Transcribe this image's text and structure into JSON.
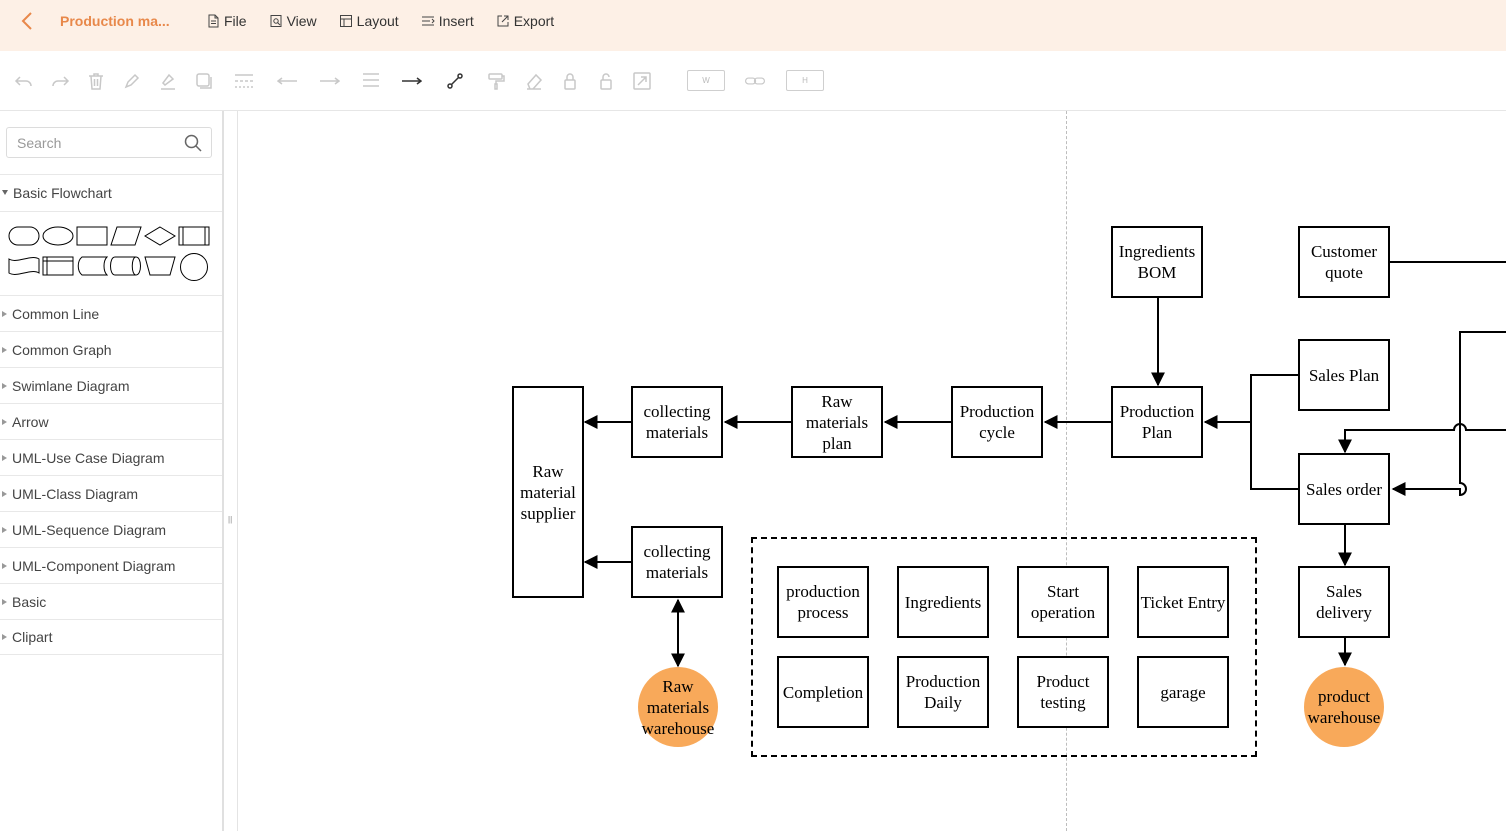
{
  "header": {
    "title": "Production ma...",
    "menu": [
      {
        "label": "File",
        "icon": "file-icon"
      },
      {
        "label": "View",
        "icon": "view-icon"
      },
      {
        "label": "Layout",
        "icon": "layout-icon"
      },
      {
        "label": "Insert",
        "icon": "insert-icon"
      },
      {
        "label": "Export",
        "icon": "export-icon"
      }
    ]
  },
  "toolbar": {
    "width_label": "W",
    "height_label": "H",
    "tools": [
      "undo-icon",
      "redo-icon",
      "delete-icon",
      "fill-color-icon",
      "line-color-icon",
      "shadow-icon",
      "line-style-icon",
      "arrow-start-icon",
      "arrow-end-icon",
      "line-weight-icon",
      "connector-straight-icon",
      "connector-elbow-icon",
      "format-painter-icon",
      "clear-format-icon",
      "lock-icon",
      "unlock-icon",
      "fit-icon",
      "link-dimensions-icon"
    ]
  },
  "sidebar": {
    "search_placeholder": "Search",
    "open_section": "Basic Flowchart",
    "sections": [
      "Common Line",
      "Common Graph",
      "Swimlane Diagram",
      "Arrow",
      "UML-Use Case Diagram",
      "UML-Class Diagram",
      "UML-Sequence Diagram",
      "UML-Component Diagram",
      "Basic",
      "Clipart"
    ]
  },
  "diagram": {
    "colors": {
      "circle_fill": "#f8a95a",
      "accent": "#e8884a",
      "header_bg": "#fdf0e6"
    },
    "nodes": {
      "raw_supplier": "Raw material supplier",
      "collecting_1": "collecting materials",
      "collecting_2": "collecting materials",
      "raw_plan": "Raw materials plan",
      "production_cycle": "Production cycle",
      "production_plan": "Production Plan",
      "ingredients_bom": "Ingredients BOM",
      "customer_quote": "Customer quote",
      "sales_plan": "Sales Plan",
      "sales_order": "Sales order",
      "sales_delivery": "Sales delivery",
      "raw_warehouse": "Raw materials warehouse",
      "product_warehouse": "product warehouse",
      "production_process": "production process",
      "ingredients": "Ingredients",
      "start_operation": "Start operation",
      "ticket_entry": "Ticket Entry",
      "completion": "Completion",
      "production_daily": "Production Daily",
      "product_testing": "Product testing",
      "garage": "garage"
    }
  }
}
